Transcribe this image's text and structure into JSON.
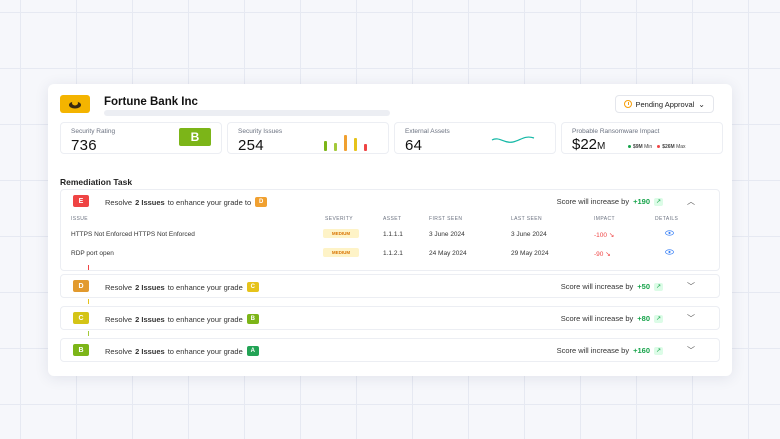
{
  "header": {
    "company": "Fortune Bank Inc",
    "status": "Pending Approval",
    "logo_icon": "fortune-bank-logo",
    "status_icon": "clock-icon"
  },
  "stats": {
    "rating": {
      "label": "Security Rating",
      "value": "736",
      "grade": "B",
      "grade_color": "#7cb518"
    },
    "issues": {
      "label": "Security Issues",
      "value": "254"
    },
    "assets": {
      "label": "External Assets",
      "value": "64"
    },
    "ransomware": {
      "label": "Probable Ransomware Impact",
      "value": "$22",
      "unit": "M",
      "min_value": "$9M",
      "min_label": "Min",
      "max_value": "$26M",
      "max_label": "Max"
    }
  },
  "remediation": {
    "title": "Remediation Task",
    "resolve_text": "Resolve",
    "issues_text": "2 Issues",
    "score_text": "Score will increase by",
    "tasks": [
      {
        "from": "E",
        "from_color": "#ef4444",
        "to": "D",
        "to_color": "#f0a030",
        "suffix": "to enhance your grade to",
        "increase": "+190",
        "expanded": true
      },
      {
        "from": "D",
        "from_color": "#e29a2e",
        "to": "C",
        "to_color": "#e6c31b",
        "suffix": "to enhance your grade",
        "increase": "+50",
        "expanded": false
      },
      {
        "from": "C",
        "from_color": "#d4c416",
        "to": "B",
        "to_color": "#7cb518",
        "suffix": "to enhance your grade",
        "increase": "+80",
        "expanded": false
      },
      {
        "from": "B",
        "from_color": "#7cb518",
        "to": "A",
        "to_color": "#22a355",
        "suffix": "to enhance your grade",
        "increase": "+160",
        "expanded": false
      }
    ],
    "columns": [
      "ISSUE",
      "SEVERITY",
      "ASSET",
      "FIRST SEEN",
      "LAST SEEN",
      "IMPACT",
      "DETAILS"
    ],
    "rows": [
      {
        "issue": "HTTPS Not Enforced HTTPS Not Enforced",
        "severity": "MEDIUM",
        "asset": "1.1.1.1",
        "first_seen": "3 June 2024",
        "last_seen": "3 June 2024",
        "impact": "-100"
      },
      {
        "issue": "RDP port open",
        "severity": "MEDIUM",
        "asset": "1.1.2.1",
        "first_seen": "24 May 2024",
        "last_seen": "29 May 2024",
        "impact": "-90"
      }
    ]
  }
}
